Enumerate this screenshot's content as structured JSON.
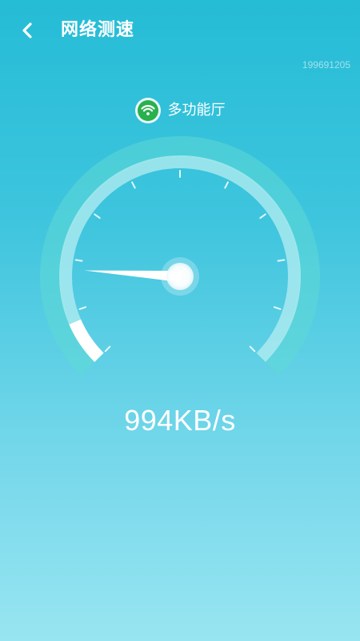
{
  "header": {
    "title": "网络测速",
    "back_icon": "chevron-left-icon"
  },
  "device_id": "199691205",
  "network": {
    "icon": "wifi-icon",
    "name": "多功能厅"
  },
  "speedometer": {
    "scale_fraction": 0.08,
    "needle_fraction": 0.18,
    "tick_count": 11
  },
  "speed": {
    "text": "994KB/s"
  },
  "colors": {
    "background_top": "#25bcd6",
    "background_bottom": "#98e5f1",
    "wifi_green": "#28b14c",
    "accent_white": "#ffffff"
  }
}
